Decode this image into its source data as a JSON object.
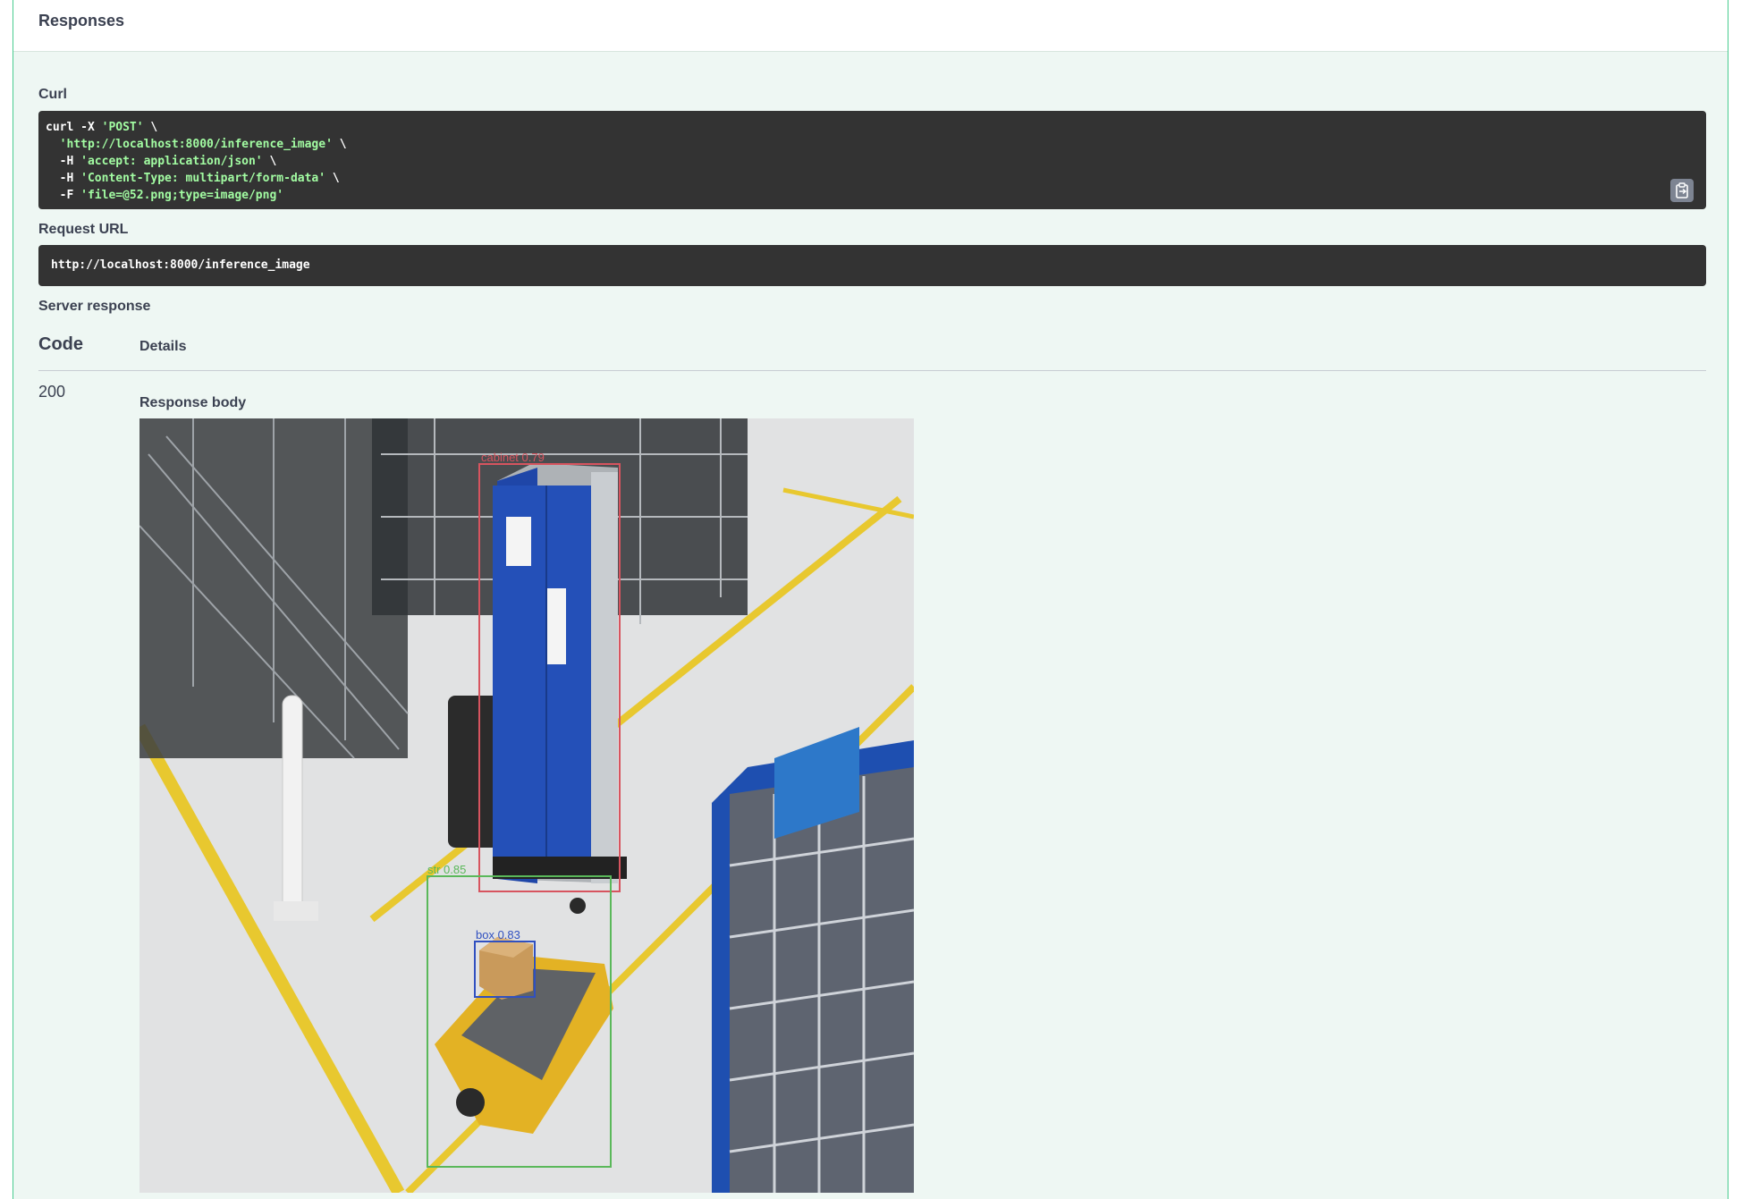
{
  "section": {
    "title": "Responses"
  },
  "curl": {
    "label": "Curl",
    "lines": [
      {
        "cmd": "curl -X ",
        "str": "'POST'",
        "tail": " \\"
      },
      {
        "cmd": "  ",
        "str": "'http://localhost:8000/inference_image'",
        "tail": " \\"
      },
      {
        "cmd": "  -H ",
        "str": "'accept: application/json'",
        "tail": " \\"
      },
      {
        "cmd": "  -H ",
        "str": "'Content-Type: multipart/form-data'",
        "tail": " \\"
      },
      {
        "cmd": "  -F ",
        "str": "'file=@52.png;type=image/png'",
        "tail": ""
      }
    ],
    "copy_icon": "clipboard-icon"
  },
  "request_url": {
    "label": "Request URL",
    "value": "http://localhost:8000/inference_image"
  },
  "server_response": {
    "label": "Server response",
    "col_code": "Code",
    "col_details": "Details",
    "code": "200",
    "body_label": "Response body"
  },
  "detections": [
    {
      "label": "cabinet",
      "score": "0.79",
      "color": "#d7545f"
    },
    {
      "label": "str",
      "score": "0.85",
      "color": "#5ab85a"
    },
    {
      "label": "box",
      "score": "0.83",
      "color": "#3050c0"
    }
  ],
  "colors": {
    "accent_green": "#49cc90",
    "panel_bg": "#eef7f3",
    "code_bg": "#333333",
    "code_string": "#a2fca2",
    "progress": "#4990e2"
  }
}
